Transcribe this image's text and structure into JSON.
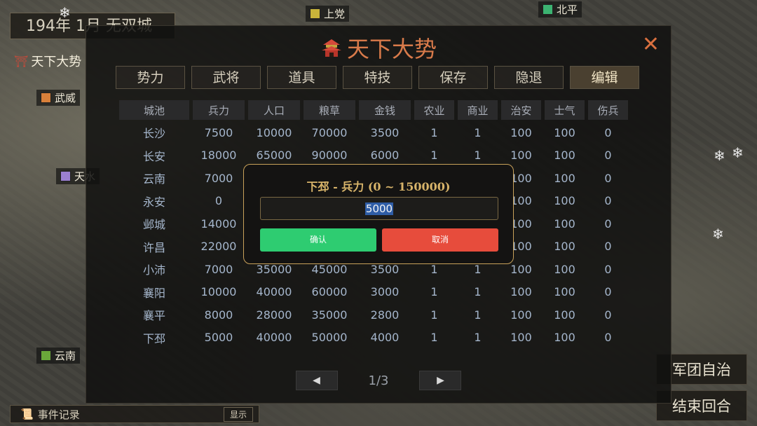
{
  "hud": {
    "date": "194年  1月  无双城",
    "left_title": "天下大势",
    "map_labels": [
      {
        "text": "上党",
        "color": "#c9b43a"
      },
      {
        "text": "北平",
        "color": "#3cb371"
      },
      {
        "text": "武威",
        "color": "#d9803a"
      },
      {
        "text": "天水",
        "color": "#9b7fd0"
      },
      {
        "text": "云南",
        "color": "#6aa83a"
      }
    ],
    "right_buttons": [
      "军团自治",
      "结束回合"
    ],
    "log_label": "事件记录",
    "log_show": "显示"
  },
  "panel": {
    "title": "天下大势",
    "close": "✕",
    "tabs": [
      "势力",
      "武将",
      "道具",
      "特技",
      "保存",
      "隐退",
      "编辑"
    ],
    "active_tab": 6,
    "columns": [
      "城池",
      "兵力",
      "人口",
      "粮草",
      "金钱",
      "农业",
      "商业",
      "治安",
      "士气",
      "伤兵"
    ],
    "rows": [
      [
        "长沙",
        "7500",
        "10000",
        "70000",
        "3500",
        "1",
        "1",
        "100",
        "100",
        "0"
      ],
      [
        "长安",
        "18000",
        "65000",
        "90000",
        "6000",
        "1",
        "1",
        "100",
        "100",
        "0"
      ],
      [
        "云南",
        "7000",
        "",
        "",
        "",
        "",
        "",
        "100",
        "100",
        "0"
      ],
      [
        "永安",
        "0",
        "",
        "",
        "",
        "",
        "",
        "100",
        "100",
        "0"
      ],
      [
        "邺城",
        "14000",
        "",
        "",
        "",
        "",
        "",
        "100",
        "100",
        "0"
      ],
      [
        "许昌",
        "22000",
        "",
        "",
        "",
        "",
        "",
        "100",
        "100",
        "0"
      ],
      [
        "小沛",
        "7000",
        "35000",
        "45000",
        "3500",
        "1",
        "1",
        "100",
        "100",
        "0"
      ],
      [
        "襄阳",
        "10000",
        "40000",
        "60000",
        "3000",
        "1",
        "1",
        "100",
        "100",
        "0"
      ],
      [
        "襄平",
        "8000",
        "28000",
        "35000",
        "2800",
        "1",
        "1",
        "100",
        "100",
        "0"
      ],
      [
        "下邳",
        "5000",
        "40000",
        "50000",
        "4000",
        "1",
        "1",
        "100",
        "100",
        "0"
      ]
    ],
    "page": "1/3",
    "prev": "◀",
    "next": "▶"
  },
  "dialog": {
    "title": "下邳 - 兵力 (0 ~ 150000)",
    "value": "5000",
    "confirm": "确认",
    "cancel": "取消"
  }
}
